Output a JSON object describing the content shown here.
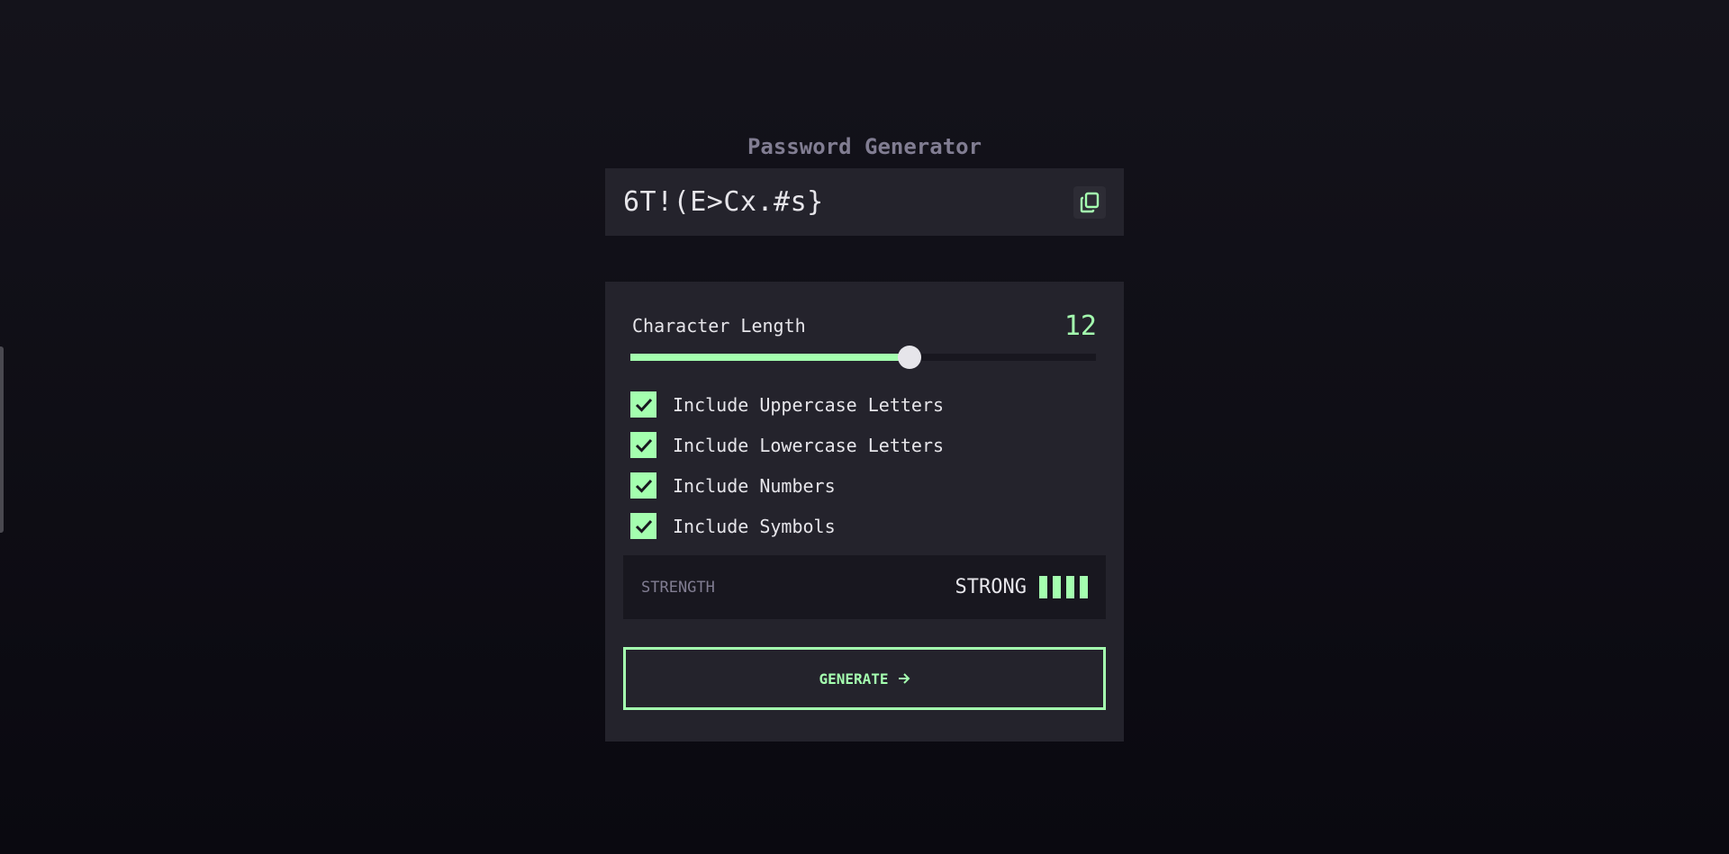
{
  "app": {
    "title": "Password Generator"
  },
  "output": {
    "password": "6T!(E>Cx.#s}",
    "copy_icon": "copy-icon"
  },
  "length": {
    "label": "Character Length",
    "value": "12",
    "slider_fraction": 0.6
  },
  "options": [
    {
      "label": "Include Uppercase Letters",
      "checked": true
    },
    {
      "label": "Include Lowercase Letters",
      "checked": true
    },
    {
      "label": "Include Numbers",
      "checked": true
    },
    {
      "label": "Include Symbols",
      "checked": true
    }
  ],
  "strength": {
    "label": "STRENGTH",
    "value": "STRONG",
    "level": 4,
    "max_level": 4
  },
  "generate": {
    "label": "GENERATE",
    "icon": "arrow-right-icon"
  },
  "colors": {
    "accent": "#a4ffaf",
    "panel": "#24232c",
    "dark": "#18171f",
    "muted": "#817d92",
    "text": "#e6e5ea"
  }
}
